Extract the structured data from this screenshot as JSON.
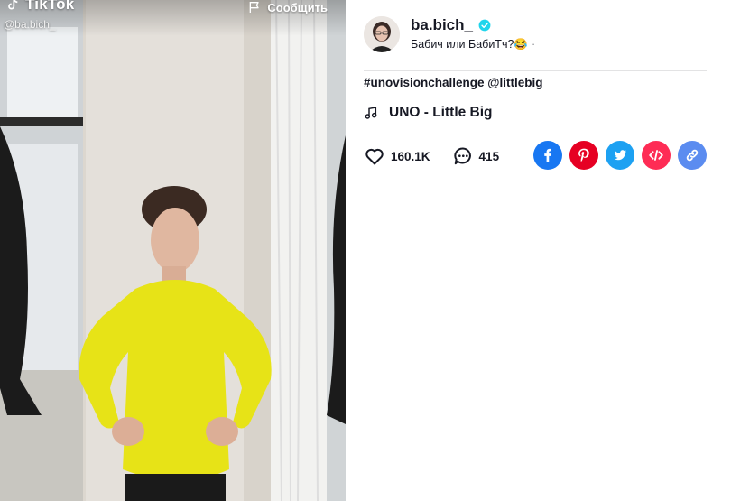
{
  "video": {
    "brand": "TikTok",
    "handle": "@ba.bich_",
    "report_label": "Сообщить"
  },
  "author": {
    "username": "ba.bich_",
    "nickname": "Бабич или БабиТч?😂",
    "separator": "·"
  },
  "caption": {
    "hashtag": "#unovisionchallenge",
    "mention": "@littlebig"
  },
  "music": {
    "title": "UNO - Little Big"
  },
  "stats": {
    "likes": "160.1K",
    "comments": "415"
  },
  "colors": {
    "facebook": "#1877f2",
    "pinterest": "#e60023",
    "twitter": "#1da1f2",
    "embed": "#fe2c55",
    "copy_link": "#5b8cf0",
    "verified": "#20d5ec",
    "text": "#161823"
  },
  "icons": [
    "tiktok-logo-icon",
    "flag-icon",
    "verified-icon",
    "music-note-icon",
    "heart-icon",
    "comment-icon",
    "facebook-icon",
    "pinterest-icon",
    "twitter-icon",
    "embed-icon",
    "link-icon"
  ]
}
